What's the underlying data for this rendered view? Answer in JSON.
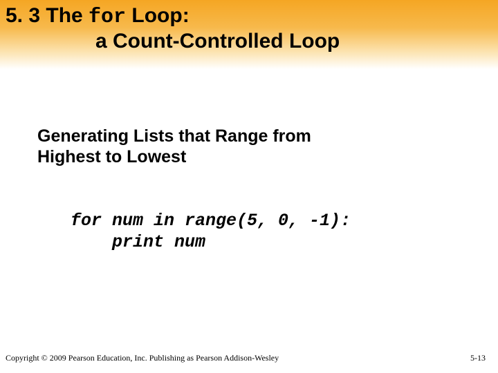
{
  "header": {
    "section_prefix": "5. 3 The ",
    "keyword": "for",
    "section_suffix": " Loop:",
    "line2": "a Count-Controlled Loop"
  },
  "subtitle": {
    "line1": "Generating Lists that Range from",
    "line2": "Highest to Lowest"
  },
  "code": {
    "line1": "for num in range(5, 0, -1):",
    "line2": "    print num"
  },
  "footer": {
    "copyright": "Copyright © 2009 Pearson Education, Inc. Publishing as Pearson Addison-Wesley",
    "page": "5-13"
  }
}
